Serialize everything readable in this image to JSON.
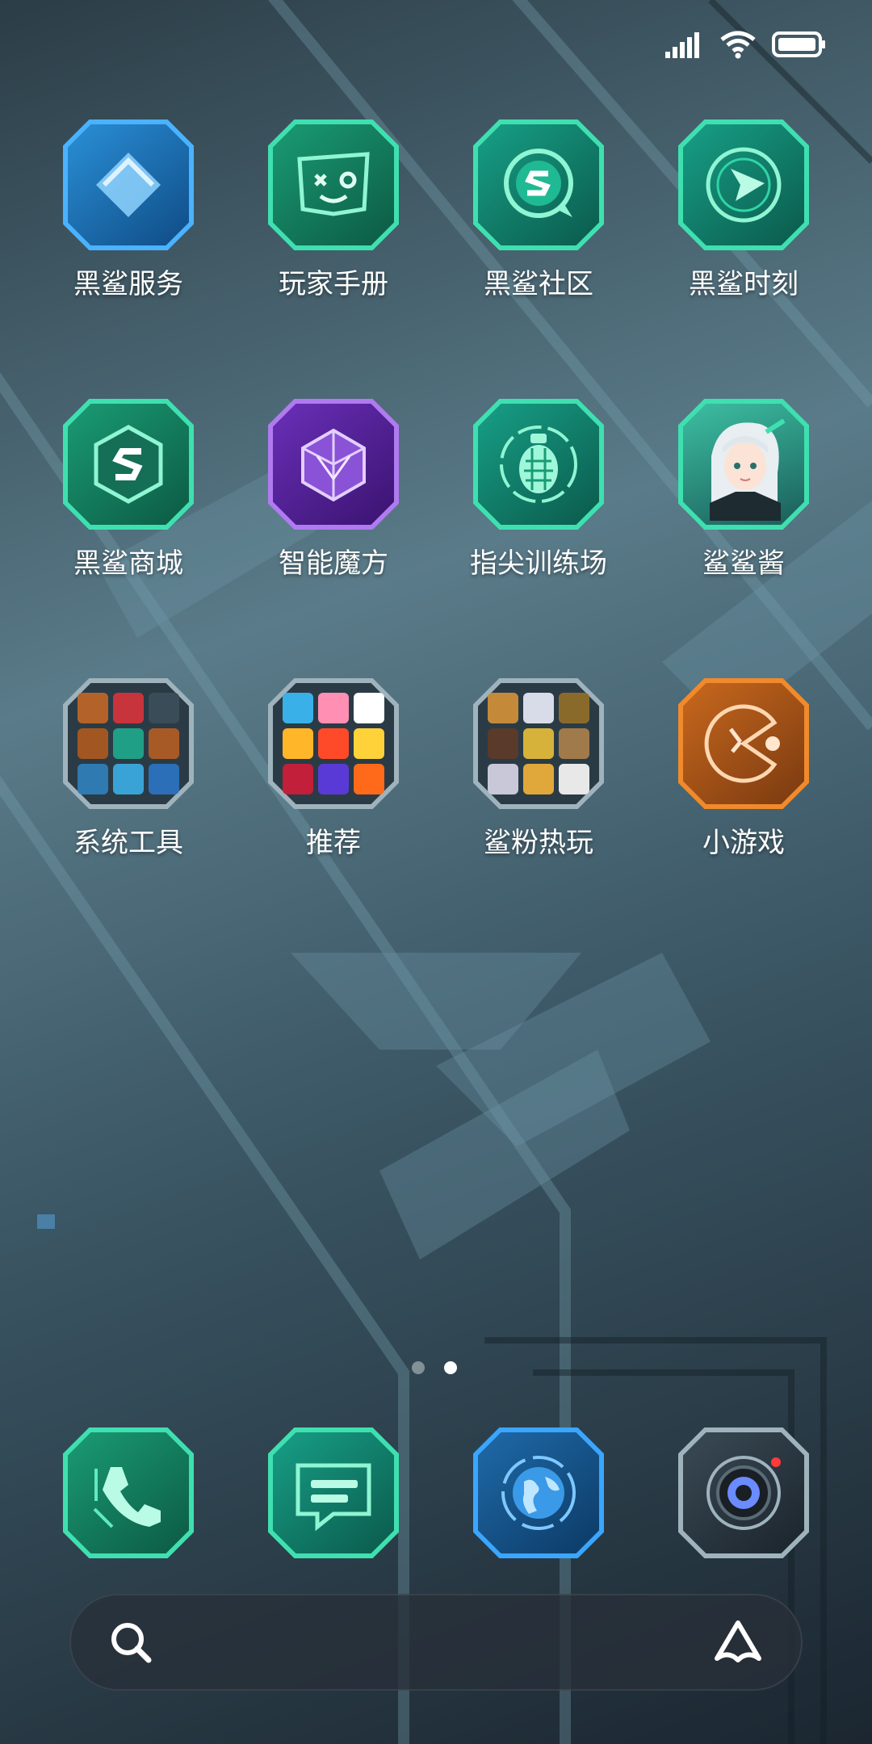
{
  "status_bar": {
    "icons": [
      "signal-icon",
      "wifi-icon",
      "battery-icon"
    ]
  },
  "apps": [
    {
      "label": "黑鲨服务",
      "icon": "heart-diamond-icon",
      "color": "#1f7bb8"
    },
    {
      "label": "玩家手册",
      "icon": "handbook-face-icon",
      "color": "#1f8a66"
    },
    {
      "label": "黑鲨社区",
      "icon": "shark-s-chat-icon",
      "color": "#1b8a76"
    },
    {
      "label": "黑鲨时刻",
      "icon": "play-ring-icon",
      "color": "#1b8a76"
    },
    {
      "label": "黑鲨商城",
      "icon": "shark-s-hex-icon",
      "color": "#1f8a66"
    },
    {
      "label": "智能魔方",
      "icon": "cube-icon",
      "color": "#6a2fb8"
    },
    {
      "label": "指尖训练场",
      "icon": "grenade-icon",
      "color": "#1b8a76"
    },
    {
      "label": "鲨鲨酱",
      "icon": "anime-avatar-icon",
      "color": "#2e9e86"
    },
    {
      "label": "系统工具",
      "icon": "folder-icon",
      "color": "#2e3f4a"
    },
    {
      "label": "推荐",
      "icon": "folder-icon",
      "color": "#2e3f4a"
    },
    {
      "label": "鲨粉热玩",
      "icon": "folder-icon",
      "color": "#2e3f4a"
    },
    {
      "label": "小游戏",
      "icon": "pacman-clock-icon",
      "color": "#c8681e"
    }
  ],
  "dock": [
    {
      "name": "phone",
      "icon": "phone-icon",
      "color": "#1f8a66"
    },
    {
      "name": "messages",
      "icon": "message-icon",
      "color": "#1b8a76"
    },
    {
      "name": "browser",
      "icon": "globe-icon",
      "color": "#1f6aa8"
    },
    {
      "name": "camera",
      "icon": "camera-lens-icon",
      "color": "#3a4a55"
    }
  ],
  "pager": {
    "count": 2,
    "active": 1
  },
  "search": {
    "icon": "search-icon",
    "assistant_icon": "assistant-icon"
  },
  "colors": {
    "accent_green": "#3fe0b0",
    "folder_border": "#9fb3bd",
    "orange": "#f08a2c",
    "purple": "#b07af0",
    "blue": "#3aa6ff"
  }
}
